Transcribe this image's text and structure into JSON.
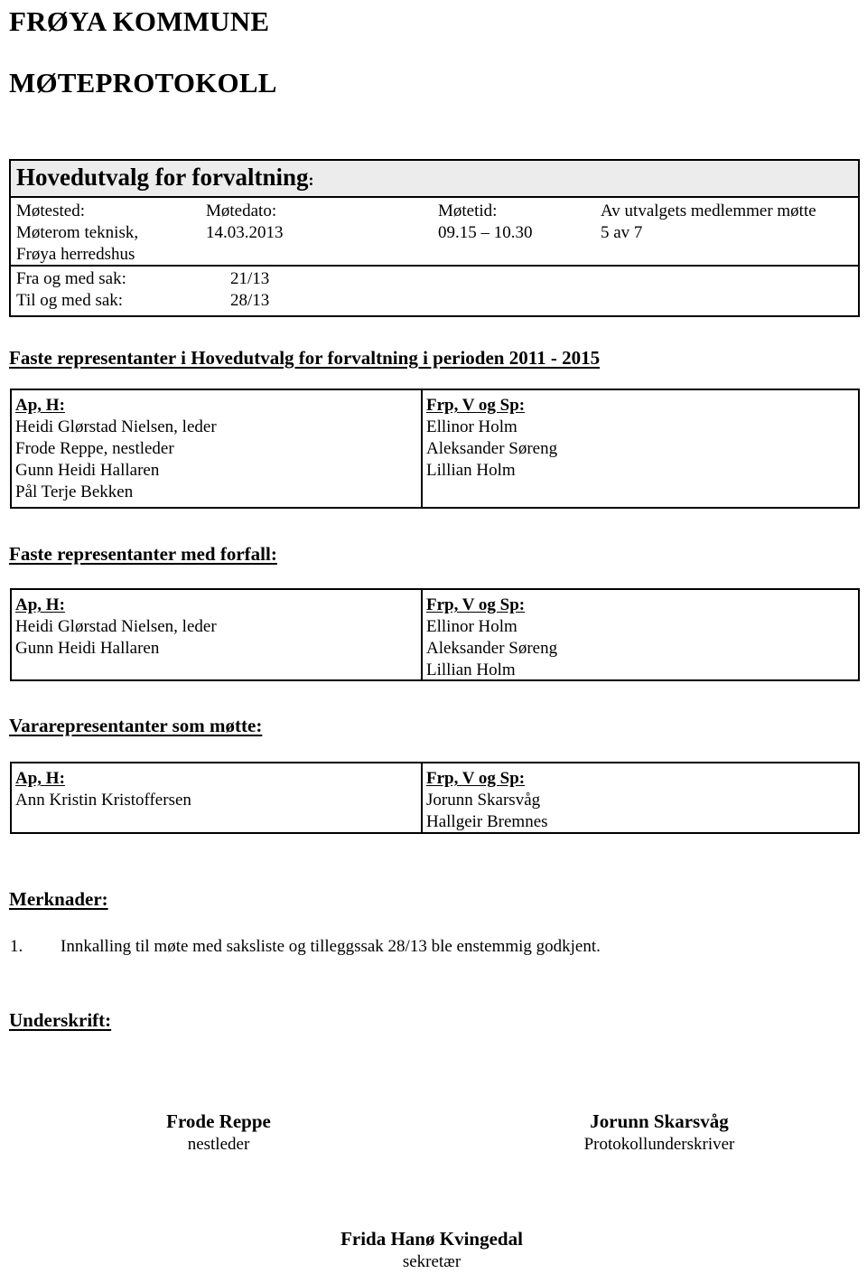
{
  "document": {
    "kommune_title": "FRØYA KOMMUNE",
    "protokoll_title": "MØTEPROTOKOLL"
  },
  "meeting_table": {
    "committee_name": "Hovedutvalg for forvaltning",
    "committee_colon": ":",
    "labels": {
      "sted": "Møtested:",
      "dato": "Møtedato:",
      "tid": "Møtetid:",
      "attendance": "Av utvalgets medlemmer møtte"
    },
    "values": {
      "sted_line1": "Møterom teknisk,",
      "sted_line2": "Frøya herredshus",
      "dato": "14.03.2013",
      "tid": "09.15 – 10.30",
      "attendance": "5 av 7"
    },
    "case_range": {
      "from_label": "Fra og med sak:",
      "from_value": "21/13",
      "to_label": "Til og med sak:",
      "to_value": "28/13"
    }
  },
  "sections": {
    "faste_representanter": {
      "heading": "Faste representanter i Hovedutvalg for forvaltning i perioden 2011 - 2015",
      "left": {
        "party": "Ap, H:",
        "members": [
          "Heidi Glørstad Nielsen, leder",
          "Frode Reppe, nestleder",
          "Gunn Heidi Hallaren",
          "Pål Terje Bekken"
        ]
      },
      "right": {
        "party": "Frp, V og Sp:",
        "members": [
          "Ellinor Holm",
          "Aleksander Søreng",
          "Lillian Holm"
        ]
      }
    },
    "med_forfall": {
      "heading": "Faste representanter med forfall:",
      "left": {
        "party": "Ap, H:",
        "members": [
          "Heidi Glørstad Nielsen, leder",
          "Gunn Heidi Hallaren"
        ]
      },
      "right": {
        "party": "Frp, V og Sp:",
        "members": [
          "Ellinor Holm",
          "Aleksander Søreng",
          "Lillian Holm"
        ]
      }
    },
    "vararepresentanter": {
      "heading": "Vararepresentanter som møtte:",
      "left": {
        "party": "Ap, H:",
        "members": [
          "Ann Kristin Kristoffersen"
        ]
      },
      "right": {
        "party": "Frp, V og Sp:",
        "members": [
          "Jorunn Skarsvåg",
          "Hallgeir Bremnes"
        ]
      }
    },
    "merknader": {
      "heading": "Merknader:",
      "items": [
        {
          "number": "1.",
          "text": "Innkalling til møte med saksliste og tilleggssak 28/13 ble enstemmig godkjent."
        }
      ]
    },
    "underskrift": {
      "heading": "Underskrift:",
      "signatures": [
        {
          "name": "Frode Reppe",
          "role": "nestleder"
        },
        {
          "name": "Jorunn Skarsvåg",
          "role": "Protokollunderskriver"
        },
        {
          "name": "Frida Hanø Kvingedal",
          "role": "sekretær"
        }
      ]
    }
  }
}
